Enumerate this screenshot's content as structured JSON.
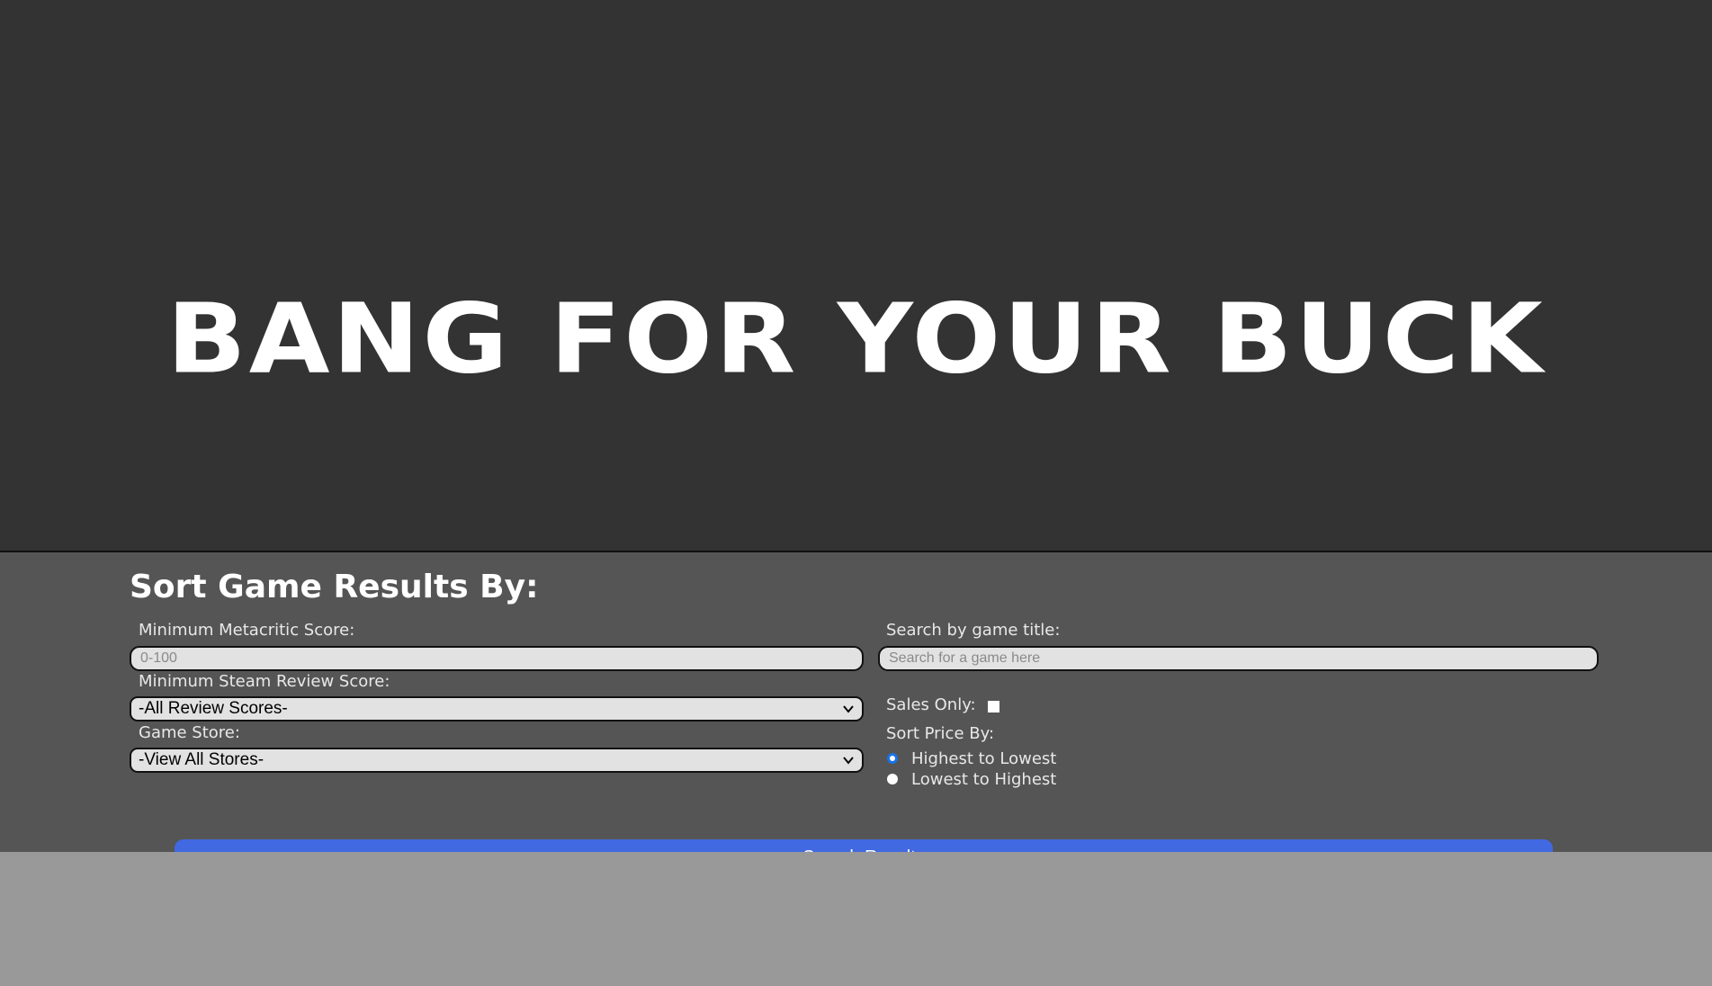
{
  "hero": {
    "title": "BANG FOR YOUR BUCK"
  },
  "filters": {
    "heading": "Sort Game Results By:",
    "metacritic": {
      "label": "Minimum Metacritic Score:",
      "placeholder": "0-100",
      "value": ""
    },
    "steam_review": {
      "label": "Minimum Steam Review Score:",
      "selected": "-All Review Scores-"
    },
    "store": {
      "label": "Game Store:",
      "selected": "-View All Stores-"
    },
    "title_search": {
      "label": "Search by game title:",
      "placeholder": "Search for a game here",
      "value": ""
    },
    "sales_only": {
      "label": "Sales Only:",
      "checked": false
    },
    "sort_price": {
      "label": "Sort Price By:",
      "options": [
        {
          "label": "Highest to Lowest",
          "checked": true
        },
        {
          "label": "Lowest to Highest",
          "checked": false
        }
      ]
    },
    "submit_label": "Search Results"
  },
  "colors": {
    "hero_bg": "#333333",
    "panel_bg": "#555555",
    "page_bg": "#999999",
    "button_bg": "#4169e1",
    "radio_accent": "#1a73e8"
  }
}
